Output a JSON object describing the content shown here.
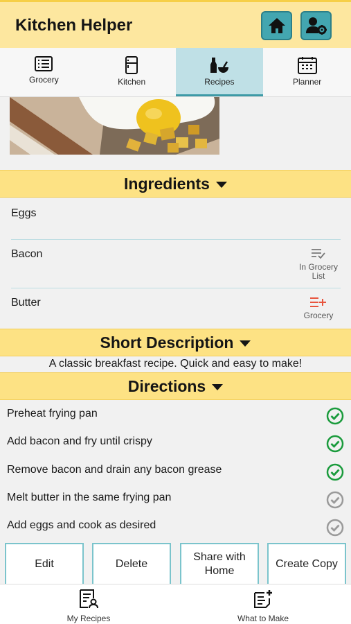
{
  "header": {
    "title": "Kitchen Helper",
    "home_icon": "home-icon",
    "profile_icon": "user-settings-icon"
  },
  "tabs": [
    {
      "label": "Grocery",
      "icon": "list-icon",
      "active": false
    },
    {
      "label": "Kitchen",
      "icon": "fridge-icon",
      "active": false
    },
    {
      "label": "Recipes",
      "icon": "bottle-bowl-icon",
      "active": true
    },
    {
      "label": "Planner",
      "icon": "calendar-icon",
      "active": false
    }
  ],
  "ingredients": {
    "title": "Ingredients",
    "items": [
      {
        "name": "Eggs"
      },
      {
        "name": "Bacon",
        "action_line1": "In Grocery",
        "action_line2": "List",
        "action_icon": "list-check-icon"
      },
      {
        "name": "Butter",
        "action_line1": "Grocery",
        "action_icon": "list-add-icon"
      }
    ]
  },
  "short_description": {
    "title": "Short Description",
    "text": "A classic breakfast recipe. Quick and easy to make!"
  },
  "directions": {
    "title": "Directions",
    "steps": [
      {
        "text": "Preheat frying pan",
        "done": true
      },
      {
        "text": "Add bacon and fry until crispy",
        "done": true
      },
      {
        "text": "Remove bacon and drain any bacon grease",
        "done": true
      },
      {
        "text": "Melt butter in the same frying pan",
        "done": false
      },
      {
        "text": "Add eggs and cook as desired",
        "done": false
      }
    ]
  },
  "actions": {
    "edit": "Edit",
    "delete": "Delete",
    "share_line1": "Share with",
    "share_line2": "Home",
    "copy": "Create Copy"
  },
  "bottom_nav": {
    "my_recipes": "My Recipes",
    "what_to_make": "What to Make"
  },
  "colors": {
    "header_bg": "#fde79f",
    "section_bg": "#fde284",
    "accent_teal": "#43a6b0",
    "check_done": "#1a9b3c",
    "check_pending": "#9a9a9a",
    "add_icon": "#e8553e"
  }
}
